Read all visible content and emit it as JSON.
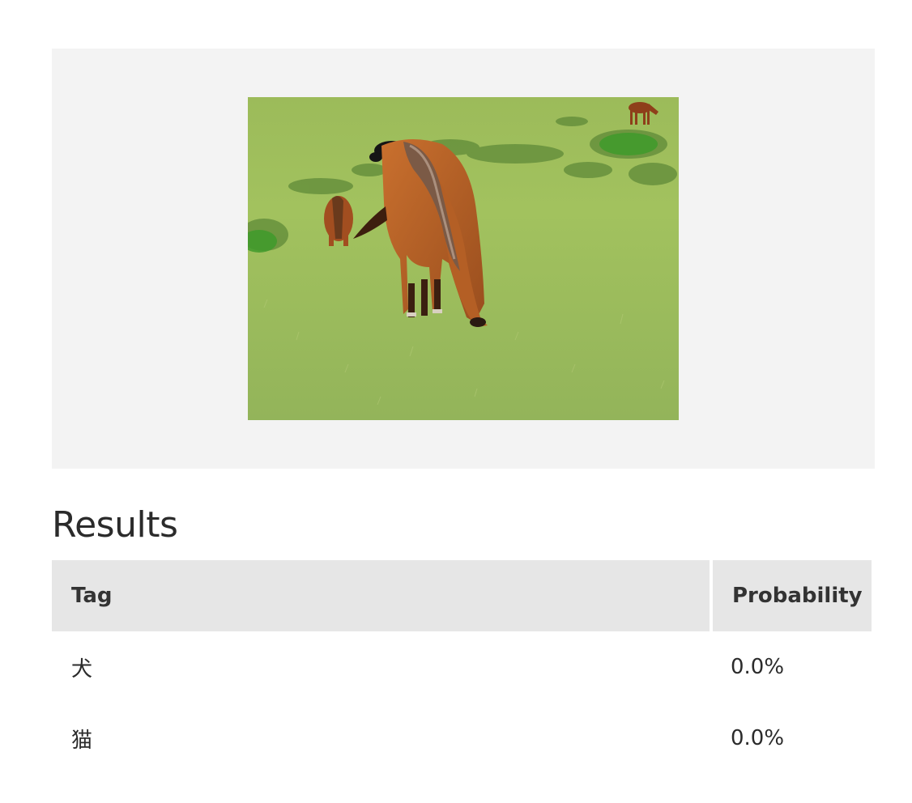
{
  "image": {
    "alt": ""
  },
  "results": {
    "heading": "Results",
    "columns": {
      "tag": "Tag",
      "probability": "Probability"
    },
    "rows": [
      {
        "tag": "犬",
        "probability": "0.0%"
      },
      {
        "tag": "猫",
        "probability": "0.0%"
      }
    ]
  },
  "colors": {
    "panel_background": "#f3f3f3",
    "header_background": "#e6e6e6",
    "text": "#2b2b2b"
  }
}
